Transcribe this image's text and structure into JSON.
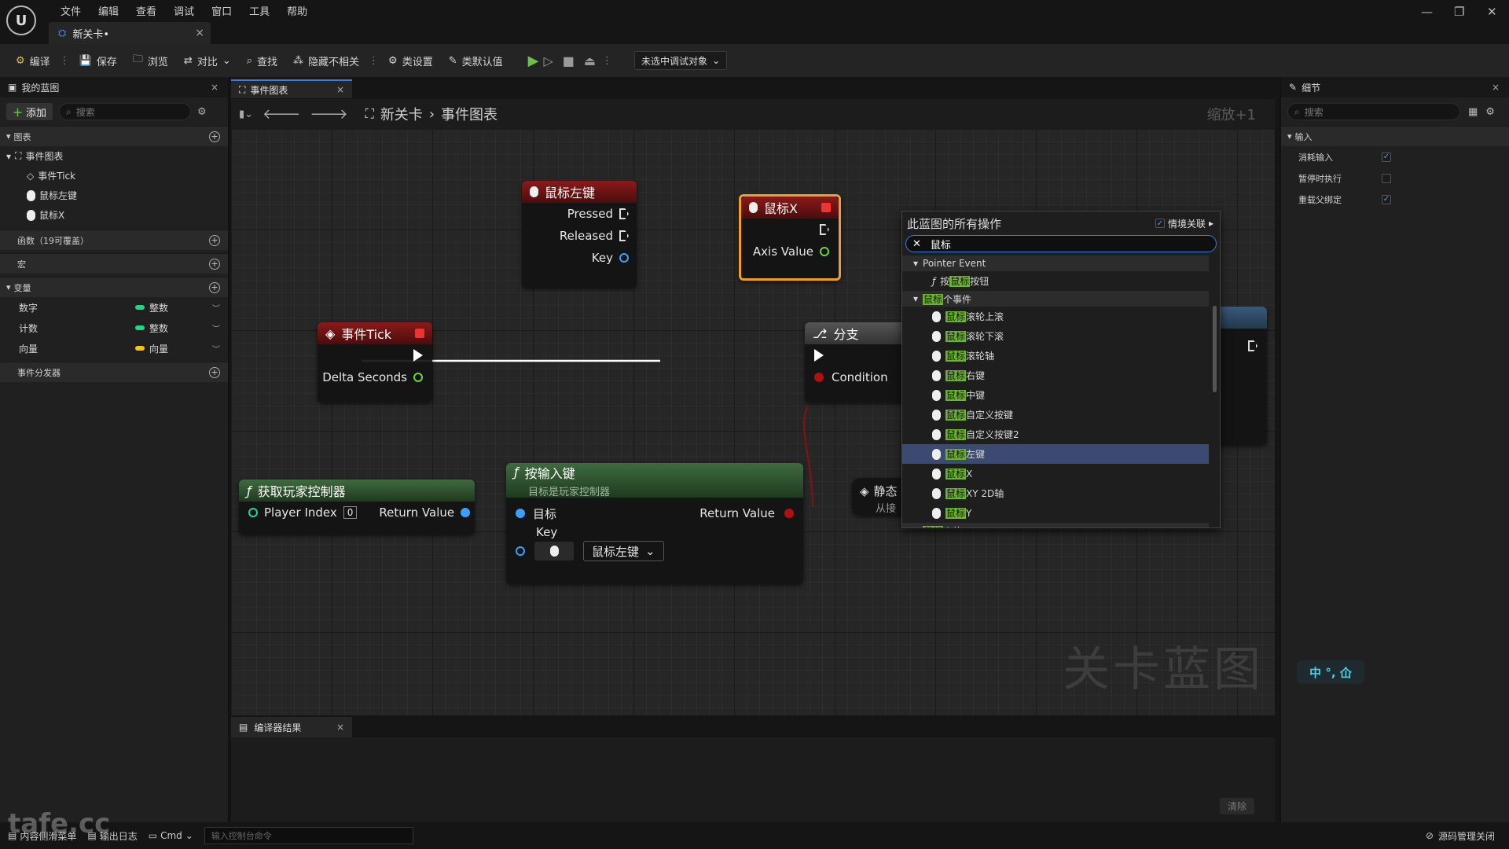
{
  "menu": [
    "文件",
    "编辑",
    "查看",
    "调试",
    "窗口",
    "工具",
    "帮助"
  ],
  "document_tab": "新关卡•",
  "toolbar": {
    "compile": "编译",
    "save": "保存",
    "browse": "浏览",
    "diff": "对比",
    "find": "查找",
    "hide_unrelated": "隐藏不相关",
    "class_settings": "类设置",
    "class_defaults": "类默认值",
    "debug_select": "未选中调试对象"
  },
  "left": {
    "tab": "我的蓝图",
    "add": "添加",
    "search_placeholder": "搜索",
    "graphs_header": "图表",
    "event_graph": "事件图表",
    "events": [
      "事件Tick",
      "鼠标左键",
      "鼠标X"
    ],
    "functions_header": "函数（19可覆盖）",
    "macros_header": "宏",
    "variables_header": "变量",
    "variables": [
      {
        "name": "数字",
        "type": "整数",
        "color": "#22d58a"
      },
      {
        "name": "计数",
        "type": "整数",
        "color": "#22d58a"
      },
      {
        "name": "向量",
        "type": "向量",
        "color": "#f5c217"
      }
    ],
    "dispatchers_header": "事件分发器"
  },
  "graph": {
    "tab": "事件图表",
    "breadcrumb_level": "新关卡",
    "breadcrumb_graph": "事件图表",
    "zoom": "缩放+1",
    "watermark": "关卡蓝图",
    "nodes": {
      "mouse_left": {
        "title": "鼠标左键",
        "pins": [
          "Pressed",
          "Released",
          "Key"
        ]
      },
      "mouse_x": {
        "title": "鼠标X",
        "pin": "Axis Value"
      },
      "event_tick": {
        "title": "事件Tick",
        "pin": "Delta Seconds"
      },
      "branch": {
        "title": "分支",
        "pin": "Condition"
      },
      "get_pc": {
        "title": "获取玩家控制器",
        "pin_in": "Player Index",
        "pin_in_value": "0",
        "pin_out": "Return Value"
      },
      "input_key": {
        "title": "按输入键",
        "subtitle": "目标是玩家控制器",
        "target": "目标",
        "key": "Key",
        "key_value": "鼠标左键",
        "return": "Return Value"
      },
      "static": {
        "title": "静态",
        "subtitle": "从接"
      }
    }
  },
  "action_menu": {
    "title": "此蓝图的所有操作",
    "context": "情境关联",
    "search_value": "鼠标",
    "items": [
      {
        "kind": "cat",
        "text": "Pointer Event"
      },
      {
        "kind": "func",
        "pre": "按",
        "hl": "鼠标",
        "post": "按钮"
      },
      {
        "kind": "cat",
        "hl": "鼠标",
        "post": "个事件"
      },
      {
        "kind": "event",
        "hl": "鼠标",
        "post": "滚轮上滚"
      },
      {
        "kind": "event",
        "hl": "鼠标",
        "post": "滚轮下滚"
      },
      {
        "kind": "event",
        "hl": "鼠标",
        "post": "滚轮轴"
      },
      {
        "kind": "event",
        "hl": "鼠标",
        "post": "右键"
      },
      {
        "kind": "event",
        "hl": "鼠标",
        "post": "中键"
      },
      {
        "kind": "event",
        "hl": "鼠标",
        "post": "自定义按键"
      },
      {
        "kind": "event",
        "hl": "鼠标",
        "post": "自定义按键2"
      },
      {
        "kind": "event",
        "hl": "鼠标",
        "post": "左键",
        "selected": true
      },
      {
        "kind": "event",
        "hl": "鼠标",
        "post": "X"
      },
      {
        "kind": "event",
        "hl": "鼠标",
        "post": "XY 2D轴"
      },
      {
        "kind": "event",
        "hl": "鼠标",
        "post": "Y"
      },
      {
        "kind": "cat",
        "hl": "鼠标",
        "post": "个值"
      }
    ]
  },
  "details": {
    "tab": "细节",
    "search_placeholder": "搜索",
    "section": "输入",
    "rows": [
      {
        "label": "消耗输入",
        "checked": true
      },
      {
        "label": "暂停时执行",
        "checked": false
      },
      {
        "label": "重载父绑定",
        "checked": true
      }
    ]
  },
  "compiler": {
    "tab": "编译器结果",
    "clear": "清除"
  },
  "status": {
    "content_drawer": "内容侧滑菜单",
    "output_log": "输出日志",
    "cmd": "Cmd",
    "console_placeholder": "输入控制台命令",
    "scm": "源码管理关闭"
  },
  "ime": "中 °, 仚",
  "overlay_brand": "tafe.cc"
}
